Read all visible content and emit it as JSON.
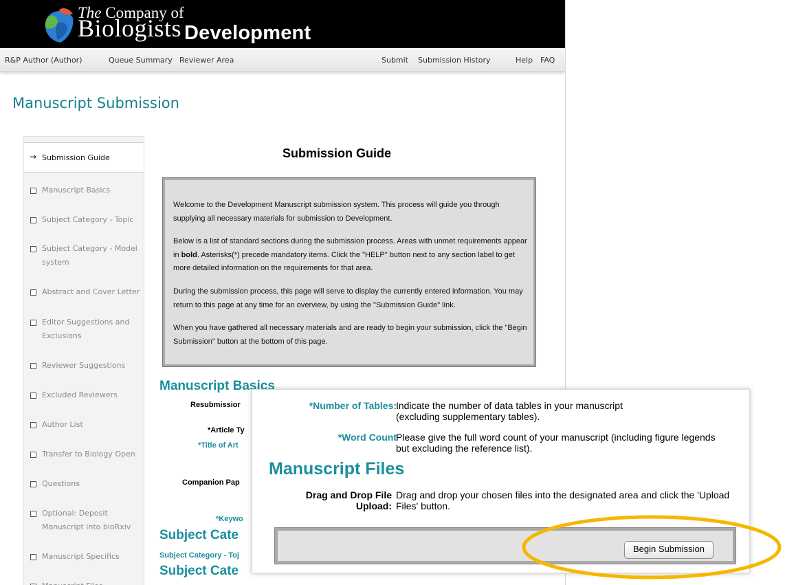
{
  "brand": {
    "logo_line1_the": "The",
    "logo_line1_rest": "Company of",
    "logo_line2": "Biologists",
    "journal": "Development"
  },
  "nav": {
    "author": "R&P Author (Author)",
    "queue": "Queue Summary",
    "reviewer": "Reviewer Area",
    "submit": "Submit",
    "history": "Submission History",
    "help": "Help",
    "faq": "FAQ"
  },
  "page_title": "Manuscript Submission",
  "sidebar": {
    "items": [
      {
        "label": "Submission Guide",
        "active": true
      },
      {
        "label": "Manuscript Basics"
      },
      {
        "label": "Subject Category - Topic"
      },
      {
        "label": "Subject Category - Model system"
      },
      {
        "label": "Abstract and Cover Letter"
      },
      {
        "label": "Editor Suggestions and Exclusions"
      },
      {
        "label": "Reviewer Suggestions"
      },
      {
        "label": "Excluded Reviewers"
      },
      {
        "label": "Author List"
      },
      {
        "label": "Transfer to Biology Open"
      },
      {
        "label": "Questions"
      },
      {
        "label": "Optional: Deposit Manuscript into bioRxiv"
      },
      {
        "label": "Manuscript Specifics"
      },
      {
        "label": "Manuscript Files"
      }
    ]
  },
  "guide": {
    "title": "Submission Guide",
    "p1": "Welcome to the Development Manuscript submission system. This process will guide you through supplying all necessary materials for submission to Development.",
    "p2_a": "Below is a list of standard sections during the submission process. Areas with unmet requirements appear in ",
    "p2_bold": "bold",
    "p2_b": ". Asterisks(*) precede mandatory items. Click the \"HELP\" button next to any section label to get more detailed information on the requirements for that area.",
    "p3": "During the submission process, this page will serve to display the currently entered information. You may return to this page at any time for an overview, by using the \"Submission Guide\" link.",
    "p4": "When you have gathered all necessary materials and are ready to begin your submission, click the \"Begin Submission\" button at the bottom of this page."
  },
  "basics": {
    "heading": "Manuscript Basics",
    "resubmission": "Resubmissior",
    "article_type": "*Article Ty",
    "title_of": "*Title of Art",
    "companion": "Companion Pap",
    "keywords": "*Keywo"
  },
  "subject": {
    "heading1": "Subject Cate",
    "topic_label": "Subject Category - Toj",
    "heading2": "Subject Cate"
  },
  "overlay": {
    "tables_label": "*Number of Tables:",
    "tables_text": "Indicate the number of data tables in your manuscript (excluding supplementary tables).",
    "wordcount_label": "*Word Count",
    "wordcount_text": "Please give the full word count of your manuscript (including figure legends but excluding the reference list).",
    "files_heading": "Manuscript Files",
    "dragdrop_label_1": "Drag and Drop File",
    "dragdrop_label_2": "Upload:",
    "dragdrop_text": "Drag and drop your chosen files into the designated area and click the 'Upload Files' button.",
    "begin_button": "Begin Submission"
  },
  "colors": {
    "teal": "#1a8f9d",
    "highlight": "#f5b800"
  }
}
